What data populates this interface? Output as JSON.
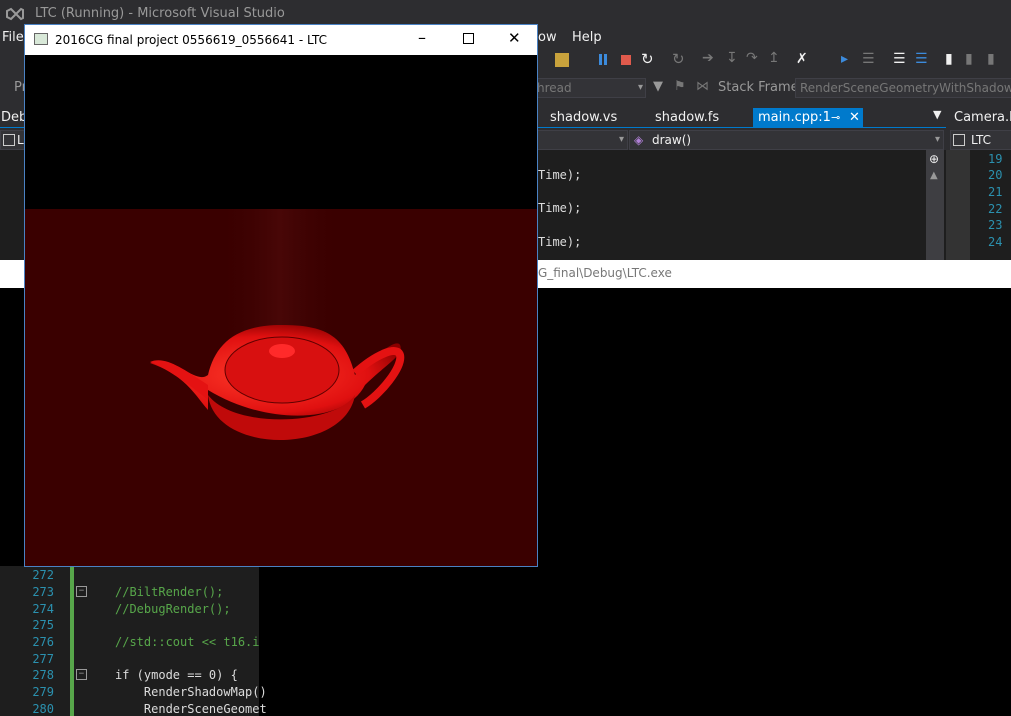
{
  "vs": {
    "window_title": "LTC (Running) - Microsoft Visual Studio",
    "menu": {
      "file": "File",
      "window_partial": "ow",
      "help": "Help"
    },
    "toolbar2": {
      "thread_partial": "hread",
      "stack_frame_label": "Stack Frame:",
      "stack_frame_value": "RenderSceneGeometryWithShadowM",
      "pr_partial": "Pr"
    },
    "tabs": {
      "debug_partial": "Deb",
      "shadow_vs": "shadow.vs",
      "shadow_fs": "shadow.fs",
      "main_cpp": "main.cpp:1",
      "camera": "Camera.hp"
    },
    "nav": {
      "left_combo": "L",
      "member_combo": "draw()",
      "right_combo": "LTC"
    },
    "code_top": [
      "Time);",
      "Time);",
      "Time);"
    ],
    "right_line_numbers": [
      "19",
      "20",
      "21",
      "22",
      "23",
      "24"
    ],
    "console_path": "G_final\\Debug\\LTC.exe",
    "lower_line_numbers": [
      "272",
      "273",
      "274",
      "275",
      "276",
      "277",
      "278",
      "279",
      "280"
    ],
    "lower_code": [
      "",
      "//BiltRender();",
      "//DebugRender();",
      "",
      "//std::cout << t16.i",
      "",
      "if (ymode == 0) {",
      "    RenderShadowMap()",
      "    RenderSceneGeomet"
    ]
  },
  "app": {
    "title": "2016CG final project 0556619_0556641 - LTC",
    "colors": {
      "floor": "#3a0000",
      "teapot": "#ff1a1a",
      "sky": "#000000"
    }
  }
}
